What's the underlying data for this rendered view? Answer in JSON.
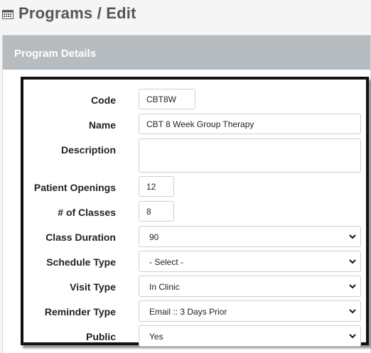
{
  "header": {
    "title": "Programs / Edit",
    "icon": "calendar-icon"
  },
  "panel": {
    "heading": "Program Details"
  },
  "form": {
    "code": {
      "label": "Code",
      "value": "CBT8W"
    },
    "name": {
      "label": "Name",
      "value": "CBT 8 Week Group Therapy"
    },
    "description": {
      "label": "Description",
      "value": ""
    },
    "patient_openings": {
      "label": "Patient Openings",
      "value": "12"
    },
    "num_classes": {
      "label": "# of Classes",
      "value": "8"
    },
    "class_duration": {
      "label": "Class Duration",
      "value": "90"
    },
    "schedule_type": {
      "label": "Schedule Type",
      "value": "- Select -"
    },
    "visit_type": {
      "label": "Visit Type",
      "value": "In Clinic"
    },
    "reminder_type": {
      "label": "Reminder Type",
      "value": "Email :: 3 Days Prior"
    },
    "public": {
      "label": "Public",
      "value": "Yes"
    }
  },
  "colors": {
    "panel_heading_bg": "#b7bcc1",
    "title_text": "#555555",
    "frame_border": "#111111"
  }
}
